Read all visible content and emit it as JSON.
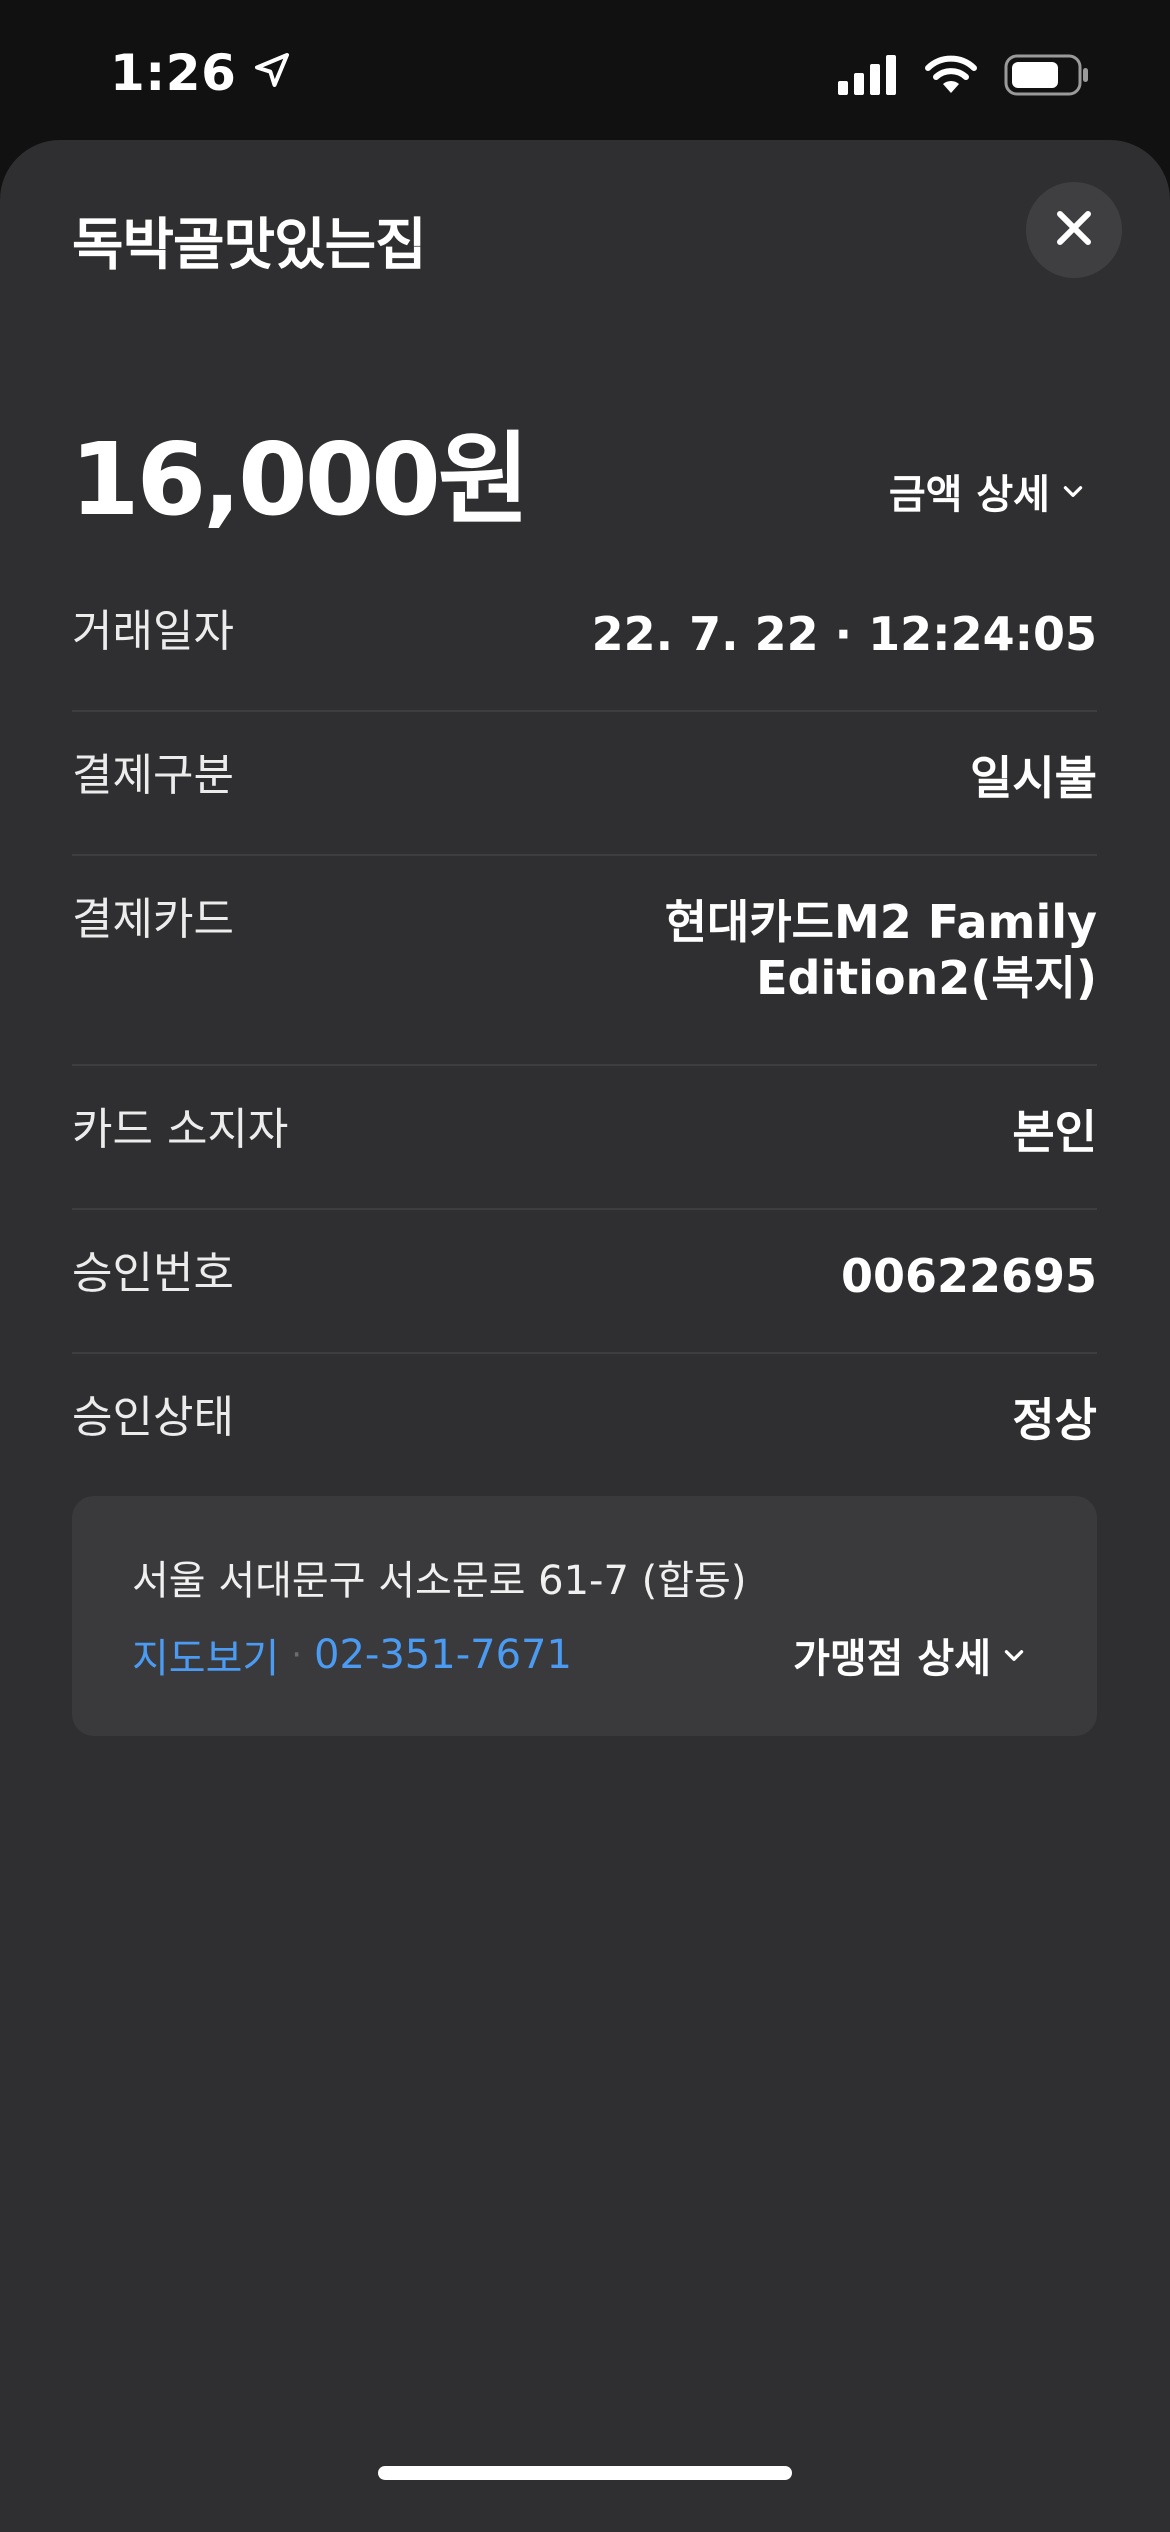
{
  "status_bar": {
    "time": "1:26",
    "location_icon": "location-arrow-icon",
    "signal_icon": "cellular-signal-icon",
    "wifi_icon": "wifi-icon",
    "battery_icon": "battery-icon"
  },
  "header": {
    "title": "독박골맛있는집",
    "close_icon": "close-icon"
  },
  "amount": {
    "value": "16,000원",
    "detail_label": "금액 상세"
  },
  "details": [
    {
      "label": "거래일자",
      "value": "22. 7. 22 · 12:24:05"
    },
    {
      "label": "결제구분",
      "value": "일시불"
    },
    {
      "label": "결제카드",
      "value": "현대카드M2 Family Edition2(복지)"
    },
    {
      "label": "카드 소지자",
      "value": "본인"
    },
    {
      "label": "승인번호",
      "value": "00622695"
    },
    {
      "label": "승인상태",
      "value": "정상"
    }
  ],
  "merchant": {
    "address": "서울 서대문구 서소문로 61-7 (합동)",
    "map_link": "지도보기",
    "separator": "·",
    "phone": "02-351-7671",
    "detail_label": "가맹점 상세"
  },
  "colors": {
    "background": "#111112",
    "sheet": "#2f2f31",
    "link": "#4b9bf2"
  }
}
